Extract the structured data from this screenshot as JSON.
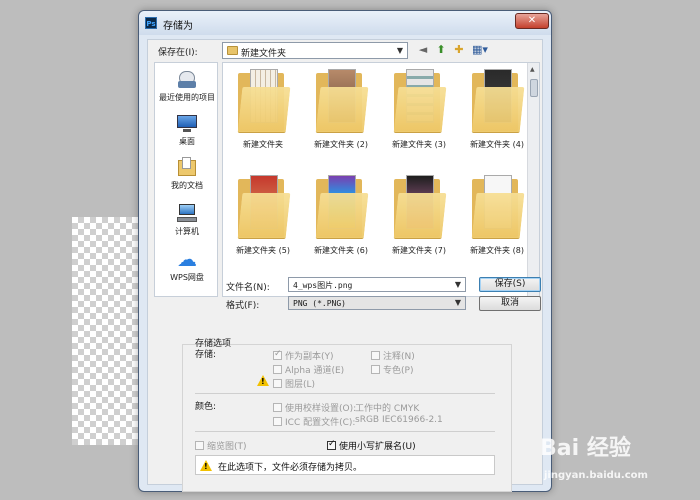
{
  "dialog": {
    "title": "存储为"
  },
  "location": {
    "label": "保存在(I):",
    "value": "新建文件夹"
  },
  "places": [
    {
      "label": "最近使用的项目",
      "icon": "recent-places-icon"
    },
    {
      "label": "桌面",
      "icon": "desktop-icon"
    },
    {
      "label": "我的文档",
      "icon": "documents-icon"
    },
    {
      "label": "计算机",
      "icon": "computer-icon"
    },
    {
      "label": "WPS网盘",
      "icon": "cloud-icon"
    }
  ],
  "files": [
    {
      "name": "新建文件夹"
    },
    {
      "name": "新建文件夹 (2)"
    },
    {
      "name": "新建文件夹 (3)"
    },
    {
      "name": "新建文件夹 (4)"
    },
    {
      "name": "新建文件夹 (5)"
    },
    {
      "name": "新建文件夹 (6)"
    },
    {
      "name": "新建文件夹 (7)"
    },
    {
      "name": "新建文件夹 (8)"
    }
  ],
  "filename": {
    "label": "文件名(N):",
    "value": "4_wps图片.png"
  },
  "format": {
    "label": "格式(F):",
    "value": "PNG (*.PNG)"
  },
  "buttons": {
    "save": "保存(S)",
    "cancel": "取消"
  },
  "options": {
    "section_title": "存储选项",
    "store_label": "存储:",
    "as_copy": "作为副本(Y)",
    "notes": "注释(N)",
    "alpha": "Alpha 通道(E)",
    "spot": "专色(P)",
    "layers": "图层(L)",
    "color_label": "颜色:",
    "proof": "使用校样设置(O):",
    "proof_value": "工作中的 CMYK",
    "icc": "ICC 配置文件(C):",
    "icc_value": "sRGB IEC61966-2.1",
    "thumbnail": "缩览图(T)",
    "lowercase_ext": "使用小写扩展名(U)",
    "warning": "在此选项下，文件必须存储为拷贝。"
  },
  "watermark": {
    "brand": "Bai 经验",
    "url": "jingyan.baidu.com"
  }
}
